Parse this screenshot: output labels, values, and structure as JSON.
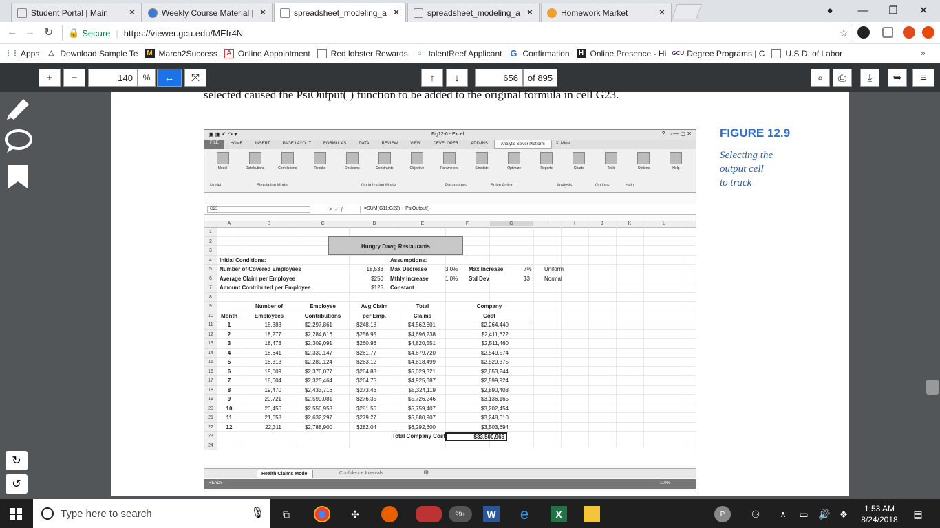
{
  "tabs": [
    {
      "label": "Student Portal | Main",
      "active": false
    },
    {
      "label": "Weekly Course Material |",
      "active": false
    },
    {
      "label": "spreadsheet_modeling_a",
      "active": true
    },
    {
      "label": "spreadsheet_modeling_a",
      "active": false
    },
    {
      "label": "Homework Market",
      "active": false
    }
  ],
  "address": {
    "secure_label": "Secure",
    "url": "https://viewer.gcu.edu/MEfr4N"
  },
  "bookmarks": [
    "Apps",
    "Download Sample Te",
    "March2Success",
    "Online Appointment",
    "Red lobster Rewards",
    "talentReef Applicant",
    "Confirmation",
    "Online Presence - Hi",
    "Degree Programs | C",
    "U.S D. of Labor"
  ],
  "pdf": {
    "zoom": "140",
    "zoom_unit": "%",
    "page": "656",
    "page_total": "of 895"
  },
  "doc": {
    "top_text": "selected caused the PsiOutput( ) function to be added to the original formula in cell G23.",
    "figure_label": "FIGURE 12.9",
    "caption_lines": [
      "Selecting the",
      "output cell",
      "to track"
    ]
  },
  "excel": {
    "title": "Fig12-6 - Excel",
    "ribbon_tabs": [
      "FILE",
      "HOME",
      "INSERT",
      "PAGE LAYOUT",
      "FORMULAS",
      "DATA",
      "REVIEW",
      "VIEW",
      "DEVELOPER",
      "ADD-INS",
      "Analytic Solver Platform",
      "XLMiner"
    ],
    "ribbon_buttons": [
      "Model",
      "Distributions",
      "Correlations",
      "Results",
      "Decisions",
      "Constraints",
      "Objective",
      "Parameters",
      "Simulate",
      "Optimize",
      "Reports",
      "Charts",
      "Tools",
      "Options",
      "Help"
    ],
    "groups": [
      "Model",
      "Simulation Model",
      "Optimization Model",
      "Parameters",
      "Solve Action",
      "Analysis",
      "Options",
      "Help"
    ],
    "namebox": "G23",
    "formula": "=SUM(G11:G22) + PsiOutput()",
    "cols": [
      "A",
      "B",
      "C",
      "D",
      "E",
      "F",
      "G",
      "H",
      "I",
      "J",
      "K",
      "L"
    ],
    "rows": [
      "1",
      "2",
      "3",
      "4",
      "5",
      "6",
      "7",
      "8",
      "9",
      "10",
      "11",
      "12",
      "13",
      "14",
      "15",
      "16",
      "17",
      "18",
      "19",
      "20",
      "21",
      "22",
      "23",
      "24"
    ],
    "sheet_title": "Hungry Dawg Restaurants",
    "init_label": "Initial Conditions:",
    "init_rows": [
      [
        "Number of Covered Employees",
        "18,533"
      ],
      [
        "Average Claim per Employee",
        "$250"
      ],
      [
        "Amount Contributed per Employee",
        "$125"
      ]
    ],
    "assump_label": "Assumptions:",
    "assump_rows": [
      [
        "Max Decrease",
        "3.0%",
        "Max Increase",
        "7%",
        "Uniform"
      ],
      [
        "Mthly Increase",
        "1.0%",
        "Std Dev",
        "$3",
        "Normal"
      ],
      [
        "Constant",
        "",
        "",
        "",
        ""
      ]
    ],
    "headers": [
      [
        "",
        "Month"
      ],
      [
        "Number of",
        "Employees"
      ],
      [
        "Employee",
        "Contributions"
      ],
      [
        "Avg Claim",
        "per Emp."
      ],
      [
        "Total",
        "Claims"
      ],
      [
        "Company",
        "Cost"
      ]
    ],
    "table": [
      [
        "1",
        "18,383",
        "$2,297,861",
        "$248.18",
        "$4,562,301",
        "$2,264,440"
      ],
      [
        "2",
        "18,277",
        "$2,284,616",
        "$256.95",
        "$4,696,238",
        "$2,411,622"
      ],
      [
        "3",
        "18,473",
        "$2,309,091",
        "$260.96",
        "$4,820,551",
        "$2,511,460"
      ],
      [
        "4",
        "18,641",
        "$2,330,147",
        "$261.77",
        "$4,879,720",
        "$2,549,574"
      ],
      [
        "5",
        "18,313",
        "$2,289,124",
        "$263.12",
        "$4,818,499",
        "$2,529,375"
      ],
      [
        "6",
        "19,009",
        "$2,376,077",
        "$264.88",
        "$5,029,321",
        "$2,653,244"
      ],
      [
        "7",
        "18,604",
        "$2,325,464",
        "$264.75",
        "$4,925,387",
        "$2,599,924"
      ],
      [
        "8",
        "19,470",
        "$2,433,716",
        "$273.46",
        "$5,324,119",
        "$2,890,403"
      ],
      [
        "9",
        "20,721",
        "$2,590,081",
        "$276.35",
        "$5,726,246",
        "$3,136,165"
      ],
      [
        "10",
        "20,456",
        "$2,556,953",
        "$281.56",
        "$5,759,407",
        "$3,202,454"
      ],
      [
        "11",
        "21,058",
        "$2,632,297",
        "$279.27",
        "$5,880,907",
        "$3,248,610"
      ],
      [
        "12",
        "22,311",
        "$2,788,900",
        "$282.04",
        "$6,292,600",
        "$3,503,694"
      ]
    ],
    "total_label": "Total Company Cost",
    "total_value": "$33,500,966",
    "sheet_tabs": [
      "Health Claims Model",
      "Confidence Intervals"
    ],
    "status": "READY",
    "zoom": "110%"
  },
  "taskbar": {
    "search": "Type here to search",
    "time": "1:53 AM",
    "date": "8/24/2018",
    "badge": "99+"
  }
}
